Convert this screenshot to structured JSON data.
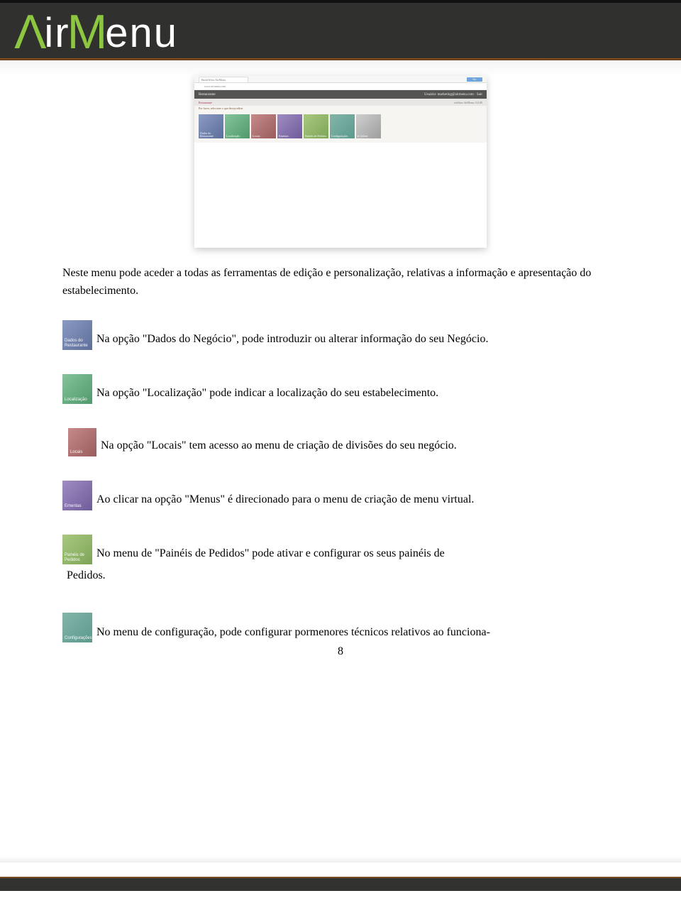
{
  "header": {
    "logo_text": "AirMenu"
  },
  "screenshot": {
    "tab_label": "BackOffice AirMenu",
    "go": "Go",
    "url": "www.airmenu.com",
    "bar_left": "Restaurante",
    "bar_right_label": "Usuário:",
    "bar_right_value": "marketing@airmenu.com · Sair",
    "sub_left": "Restaurante",
    "sub_right": "créditos AirMenu: 0.0,00",
    "hint": "Por favor, selecione o que deseja editar",
    "tiles": [
      {
        "label": "Dados do Restaurante",
        "cls": "t-blue"
      },
      {
        "label": "Localização",
        "cls": "t-green"
      },
      {
        "label": "Locais",
        "cls": "t-red"
      },
      {
        "label": "Ementas",
        "cls": "t-purple"
      },
      {
        "label": "Painéis de Pedidos",
        "cls": "t-lime"
      },
      {
        "label": "Configurações",
        "cls": "t-teal"
      },
      {
        "label": "Ir Online",
        "cls": "t-grey"
      }
    ]
  },
  "intro": "Neste menu pode aceder a todas as ferramentas de edição e personalização, relativas a informação e apresentação do estabelecimento.",
  "options": [
    {
      "tile_label": "Dados do Restaurante",
      "cls": "t-blue",
      "text": "Na opção \"Dados do Negócio\", pode introduzir ou alterar informação do seu Negócio."
    },
    {
      "tile_label": "Localização",
      "cls": "t-green",
      "text": "Na opção \"Localização\" pode indicar a localização do seu estabelecimento."
    },
    {
      "tile_label": "Locais",
      "cls": "t-red",
      "text": "Na opção \"Locais\" tem acesso ao menu de criação de divisões do seu negócio."
    },
    {
      "tile_label": "Ementas",
      "cls": "t-purple",
      "text": "Ao clicar na opção \"Menus\" é direcionado para o menu de criação de menu virtual."
    },
    {
      "tile_label": "Painéis de Pedidos",
      "cls": "t-lime",
      "text": "No menu de \"Painéis de Pedidos\" pode ativar e configurar os seus painéis de",
      "extra": "Pedidos."
    },
    {
      "tile_label": "Configurações",
      "cls": "t-teal",
      "text": "No menu de configuração, pode configurar pormenores técnicos relativos ao funciona-"
    }
  ],
  "page_number": "8"
}
